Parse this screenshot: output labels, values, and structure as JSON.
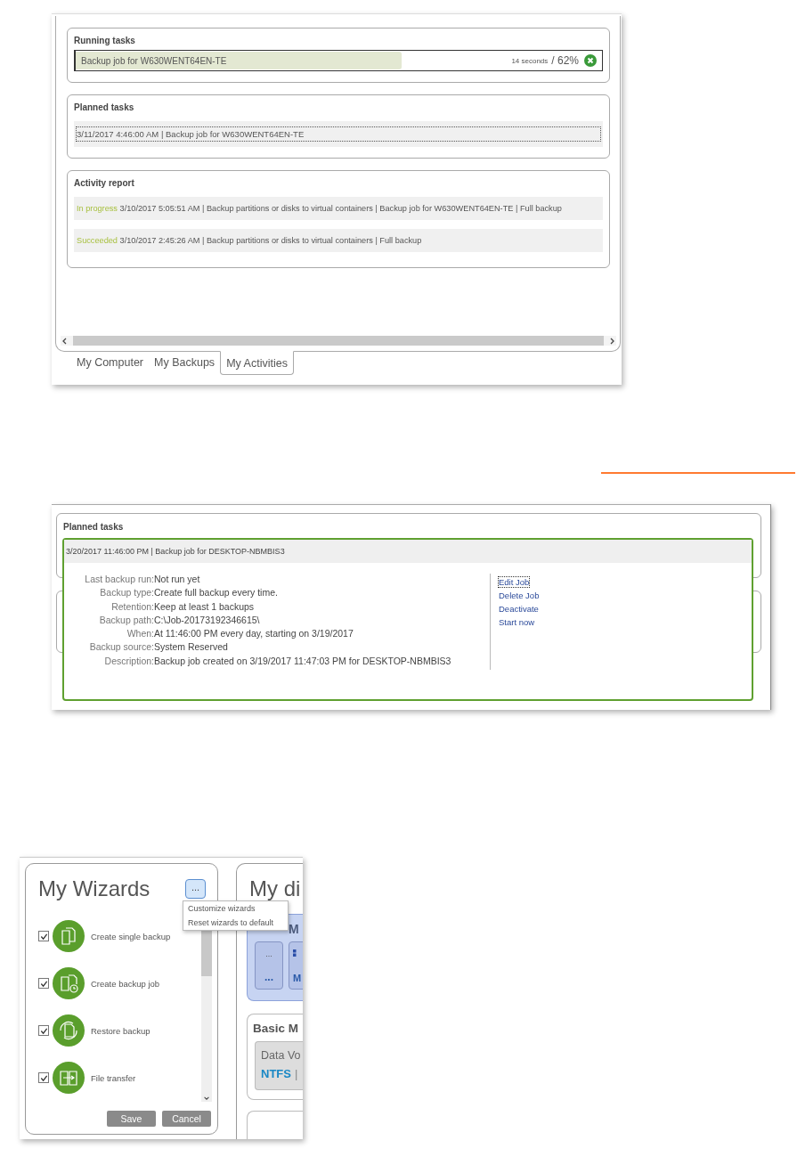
{
  "activities_view": {
    "running": {
      "title": "Running tasks",
      "tasks": [
        {
          "name": "Backup job for W630WENT64EN-TE",
          "remaining": "14 seconds",
          "percent": "/ 62%",
          "level": 0.62
        }
      ]
    },
    "planned": {
      "title": "Planned tasks",
      "items": [
        {
          "text": "3/11/2017 4:46:00 AM | Backup job for W630WENT64EN-TE",
          "focused": true
        }
      ]
    },
    "activity": {
      "title": "Activity report",
      "entries": [
        {
          "status": "In progress",
          "text": "3/10/2017 5:05:51 AM | Backup partitions or disks to virtual containers | Backup job for W630WENT64EN-TE | Full backup"
        },
        {
          "status": "Succeeded",
          "text": "3/10/2017 2:45:26 AM | Backup partitions or disks to virtual containers | Full backup"
        }
      ]
    },
    "tabs": [
      {
        "label": "My Computer",
        "selected": false
      },
      {
        "label": "My Backups",
        "selected": false
      },
      {
        "label": "My Activities",
        "selected": true
      }
    ]
  },
  "job_view": {
    "title": "Planned tasks",
    "job": {
      "header": "3/20/2017 11:46:00 PM | Backup job for DESKTOP-NBMBIS3",
      "expanded": true,
      "details": [
        {
          "label": "Last backup run:",
          "value": "Not run yet"
        },
        {
          "label": "Backup type:",
          "value": "Create full backup every time."
        },
        {
          "label": "Retention:",
          "value": "Keep at least 1 backups"
        },
        {
          "label": "Backup path:",
          "value": "C:\\Job-20173192346615\\"
        },
        {
          "label": "When:",
          "value": "At 11:46:00 PM every day, starting on 3/19/2017"
        },
        {
          "label": "Backup source:",
          "value": "System Reserved"
        },
        {
          "label": "Description:",
          "value": "Backup job created on 3/19/2017 11:47:03 PM for DESKTOP-NBMBIS3"
        }
      ],
      "actions": [
        {
          "label": "Edit Job",
          "focused": true
        },
        {
          "label": "Delete Job",
          "focused": false
        },
        {
          "label": "Deactivate",
          "focused": false
        },
        {
          "label": "Start now",
          "focused": false
        }
      ]
    }
  },
  "wizards_view": {
    "title": "My Wizards",
    "menu_button": "...",
    "menu": [
      "Customize wizards",
      "Reset wizards to default"
    ],
    "items": [
      {
        "label": "Create single backup",
        "checked": true,
        "kind": "single"
      },
      {
        "label": "Create backup job",
        "checked": true,
        "kind": "job"
      },
      {
        "label": "Restore backup",
        "checked": true,
        "kind": "restore"
      },
      {
        "label": "File transfer",
        "checked": true,
        "kind": "transfer"
      }
    ],
    "buttons": [
      "Save",
      "Cancel"
    ],
    "disks": {
      "title": "My di",
      "card_title": "M",
      "tiles": [
        {
          "top": "...",
          "bottom": "..."
        },
        {
          "bottom": "M"
        }
      ],
      "basic_title": "Basic M",
      "volume": "Data Vo",
      "fs": "NTFS",
      "separator": "|"
    }
  }
}
